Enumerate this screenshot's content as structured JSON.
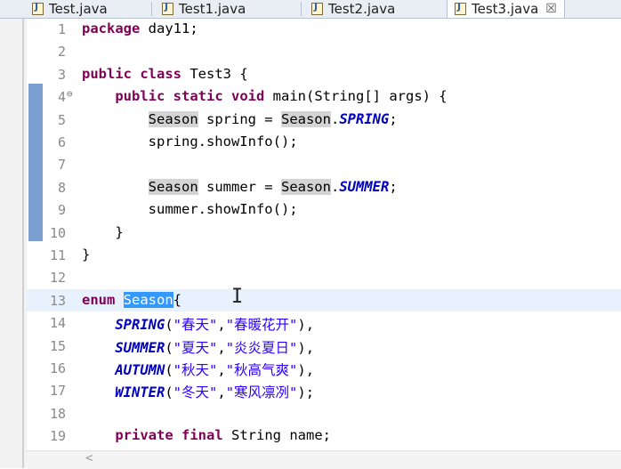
{
  "tabs": [
    {
      "label": "Test.java"
    },
    {
      "label": "Test1.java"
    },
    {
      "label": "Test2.java"
    },
    {
      "label": "Test3.java",
      "close": "☒",
      "active": true
    }
  ],
  "editor": {
    "lines": [
      {
        "n": "1",
        "tokens": [
          {
            "t": "package",
            "c": "kw"
          },
          {
            "t": " day11;"
          }
        ]
      },
      {
        "n": "2",
        "tokens": []
      },
      {
        "n": "3",
        "tokens": [
          {
            "t": "public",
            "c": "kw"
          },
          {
            "t": " "
          },
          {
            "t": "class",
            "c": "kw"
          },
          {
            "t": " Test3 {"
          }
        ]
      },
      {
        "n": "4",
        "fold": "⊖",
        "tokens": [
          {
            "t": "    "
          },
          {
            "t": "public",
            "c": "kw"
          },
          {
            "t": " "
          },
          {
            "t": "static",
            "c": "kw"
          },
          {
            "t": " "
          },
          {
            "t": "void",
            "c": "kw"
          },
          {
            "t": " main(String[] args) {"
          }
        ]
      },
      {
        "n": "5",
        "tokens": [
          {
            "t": "        "
          },
          {
            "t": "Season",
            "c": "mk"
          },
          {
            "t": " spring = "
          },
          {
            "t": "Season",
            "c": "mk"
          },
          {
            "t": "."
          },
          {
            "t": "SPRING",
            "c": "en"
          },
          {
            "t": ";"
          }
        ]
      },
      {
        "n": "6",
        "tokens": [
          {
            "t": "        spring.showInfo();"
          }
        ]
      },
      {
        "n": "7",
        "tokens": []
      },
      {
        "n": "8",
        "tokens": [
          {
            "t": "        "
          },
          {
            "t": "Season",
            "c": "mk"
          },
          {
            "t": " summer = "
          },
          {
            "t": "Season",
            "c": "mk"
          },
          {
            "t": "."
          },
          {
            "t": "SUMMER",
            "c": "en"
          },
          {
            "t": ";"
          }
        ]
      },
      {
        "n": "9",
        "tokens": [
          {
            "t": "        summer.showInfo();"
          }
        ]
      },
      {
        "n": "10",
        "tokens": [
          {
            "t": "    }"
          }
        ]
      },
      {
        "n": "11",
        "tokens": [
          {
            "t": "}"
          }
        ]
      },
      {
        "n": "12",
        "tokens": []
      },
      {
        "n": "13",
        "current": true,
        "tokens": [
          {
            "t": "enum",
            "c": "kw"
          },
          {
            "t": " "
          },
          {
            "t": "Season",
            "c": "sel"
          },
          {
            "t": "{"
          }
        ]
      },
      {
        "n": "14",
        "tokens": [
          {
            "t": "    "
          },
          {
            "t": "SPRING",
            "c": "en"
          },
          {
            "t": "("
          },
          {
            "t": "\"春天\"",
            "c": "str"
          },
          {
            "t": ","
          },
          {
            "t": "\"春暖花开\"",
            "c": "str"
          },
          {
            "t": "),"
          }
        ]
      },
      {
        "n": "15",
        "tokens": [
          {
            "t": "    "
          },
          {
            "t": "SUMMER",
            "c": "en"
          },
          {
            "t": "("
          },
          {
            "t": "\"夏天\"",
            "c": "str"
          },
          {
            "t": ","
          },
          {
            "t": "\"炎炎夏日\"",
            "c": "str"
          },
          {
            "t": "),"
          }
        ]
      },
      {
        "n": "16",
        "tokens": [
          {
            "t": "    "
          },
          {
            "t": "AUTUMN",
            "c": "en"
          },
          {
            "t": "("
          },
          {
            "t": "\"秋天\"",
            "c": "str"
          },
          {
            "t": ","
          },
          {
            "t": "\"秋高气爽\"",
            "c": "str"
          },
          {
            "t": "),"
          }
        ]
      },
      {
        "n": "17",
        "tokens": [
          {
            "t": "    "
          },
          {
            "t": "WINTER",
            "c": "en"
          },
          {
            "t": "("
          },
          {
            "t": "\"冬天\"",
            "c": "str"
          },
          {
            "t": ","
          },
          {
            "t": "\"寒风凛冽\"",
            "c": "str"
          },
          {
            "t": ");"
          }
        ]
      },
      {
        "n": "18",
        "tokens": []
      },
      {
        "n": "19",
        "tokens": [
          {
            "t": "    "
          },
          {
            "t": "private",
            "c": "kw"
          },
          {
            "t": " "
          },
          {
            "t": "final",
            "c": "kw"
          },
          {
            "t": " String name;"
          }
        ]
      }
    ]
  },
  "scrollbar": {
    "left_arrow": "<"
  },
  "colors": {
    "keyword": "#7f0055",
    "enum_constant": "#0000c0",
    "string": "#2a00ff",
    "selection": "#3399ff",
    "change_bar": "#7b9fd0"
  }
}
